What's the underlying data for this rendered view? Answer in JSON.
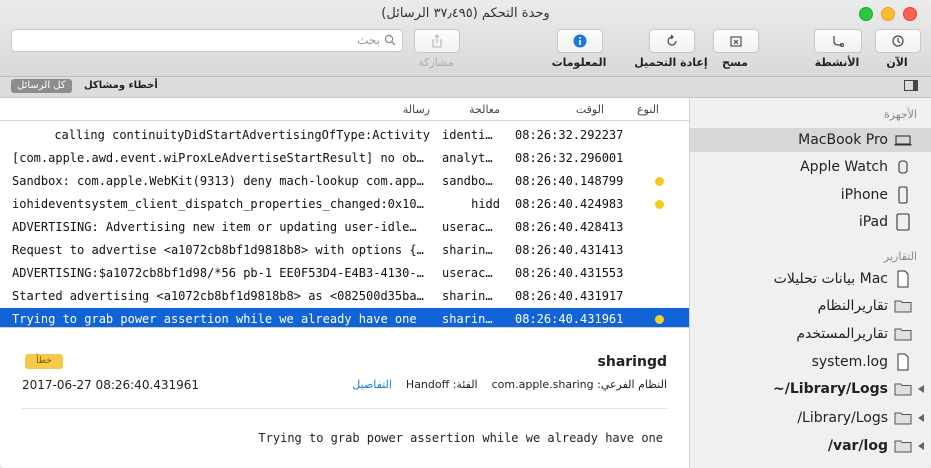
{
  "window": {
    "title": "وحدة التحكم (٣٧٫٤٩٥ الرسائل)"
  },
  "toolbar": {
    "now_label": "الآن",
    "activities_label": "الأنشطة",
    "clear_label": "مسح",
    "reload_label": "إعادة التحميل",
    "info_label": "المعلومات",
    "share_label": "مشاركة",
    "search_placeholder": "بحث"
  },
  "filters": {
    "all_messages": "كل الرسائل",
    "errors_faults": "أخطاء ومشاكل"
  },
  "table": {
    "headers": {
      "type": "النوع",
      "time": "الوقت",
      "process": "معالجة",
      "message": "رسالة"
    },
    "rows": [
      {
        "message": "calling continuityDidStartAdvertisingOfType:Activity",
        "process": "identi…",
        "time": "08:26:32.292237",
        "dot": false
      },
      {
        "message": "[com.apple.awd.event.wiProxLeAdvertiseStartResult] no ob…",
        "process": "analyt…",
        "time": "08:26:32.296001",
        "dot": false
      },
      {
        "message": "Sandbox: com.apple.WebKit(9313) deny mach-lookup com.app…",
        "process": "sandbo…",
        "time": "08:26:40.148799",
        "dot": true
      },
      {
        "message": "iohideventsystem_client_dispatch_properties_changed:0x10…",
        "process": "hidd",
        "time": "08:26:40.424983",
        "dot": true
      },
      {
        "message": " ADVERTISING: Advertising new item or updating user-idle…",
        "process": "userac…",
        "time": "08:26:40.428413",
        "dot": false
      },
      {
        "message": "Request to advertise <a1072cb8bf1d9818b8> with options {…",
        "process": "sharin…",
        "time": "08:26:40.431413",
        "dot": false
      },
      {
        "message": "ADVERTISING:$a1072cb8bf1d98/*56 pb-1 EE0F53D4-E4B3-4130-…",
        "process": "userac…",
        "time": "08:26:40.431553",
        "dot": false
      },
      {
        "message": "Started advertising <a1072cb8bf1d9818b8> as <082500d35ba…",
        "process": "sharin…",
        "time": "08:26:40.431917",
        "dot": false
      },
      {
        "message": " Trying to grab power assertion while we already have one",
        "process": "sharin…",
        "time": "08:26:40.431961",
        "dot": true
      }
    ]
  },
  "detail": {
    "badge": "خطأ",
    "process": "sharingd",
    "timestamp": "2017-06-27 08:26:40.431961",
    "subsystem_label": "النظام الفرعي:",
    "subsystem_value": "com.apple.sharing",
    "category_label": "الفئة:",
    "category_value": "Handoff",
    "details_link": "التفاصيل",
    "message": "Trying to grab power assertion while we already have one"
  },
  "sidebar": {
    "devices_header": "الأجهزة",
    "devices": [
      "MacBook Pro",
      "Apple Watch",
      "iPhone",
      "iPad"
    ],
    "reports_header": "التقارير",
    "reports": [
      "بيانات تحليلات Mac",
      "تقاريرالنظام",
      "تقاريرالمستخدم",
      "system.log",
      "~/Library/Logs",
      "/Library/Logs",
      "/var/log"
    ]
  },
  "colors": {
    "selection": "#1163d8",
    "warning_dot": "#f7c81e",
    "link": "#1a7fe0"
  }
}
